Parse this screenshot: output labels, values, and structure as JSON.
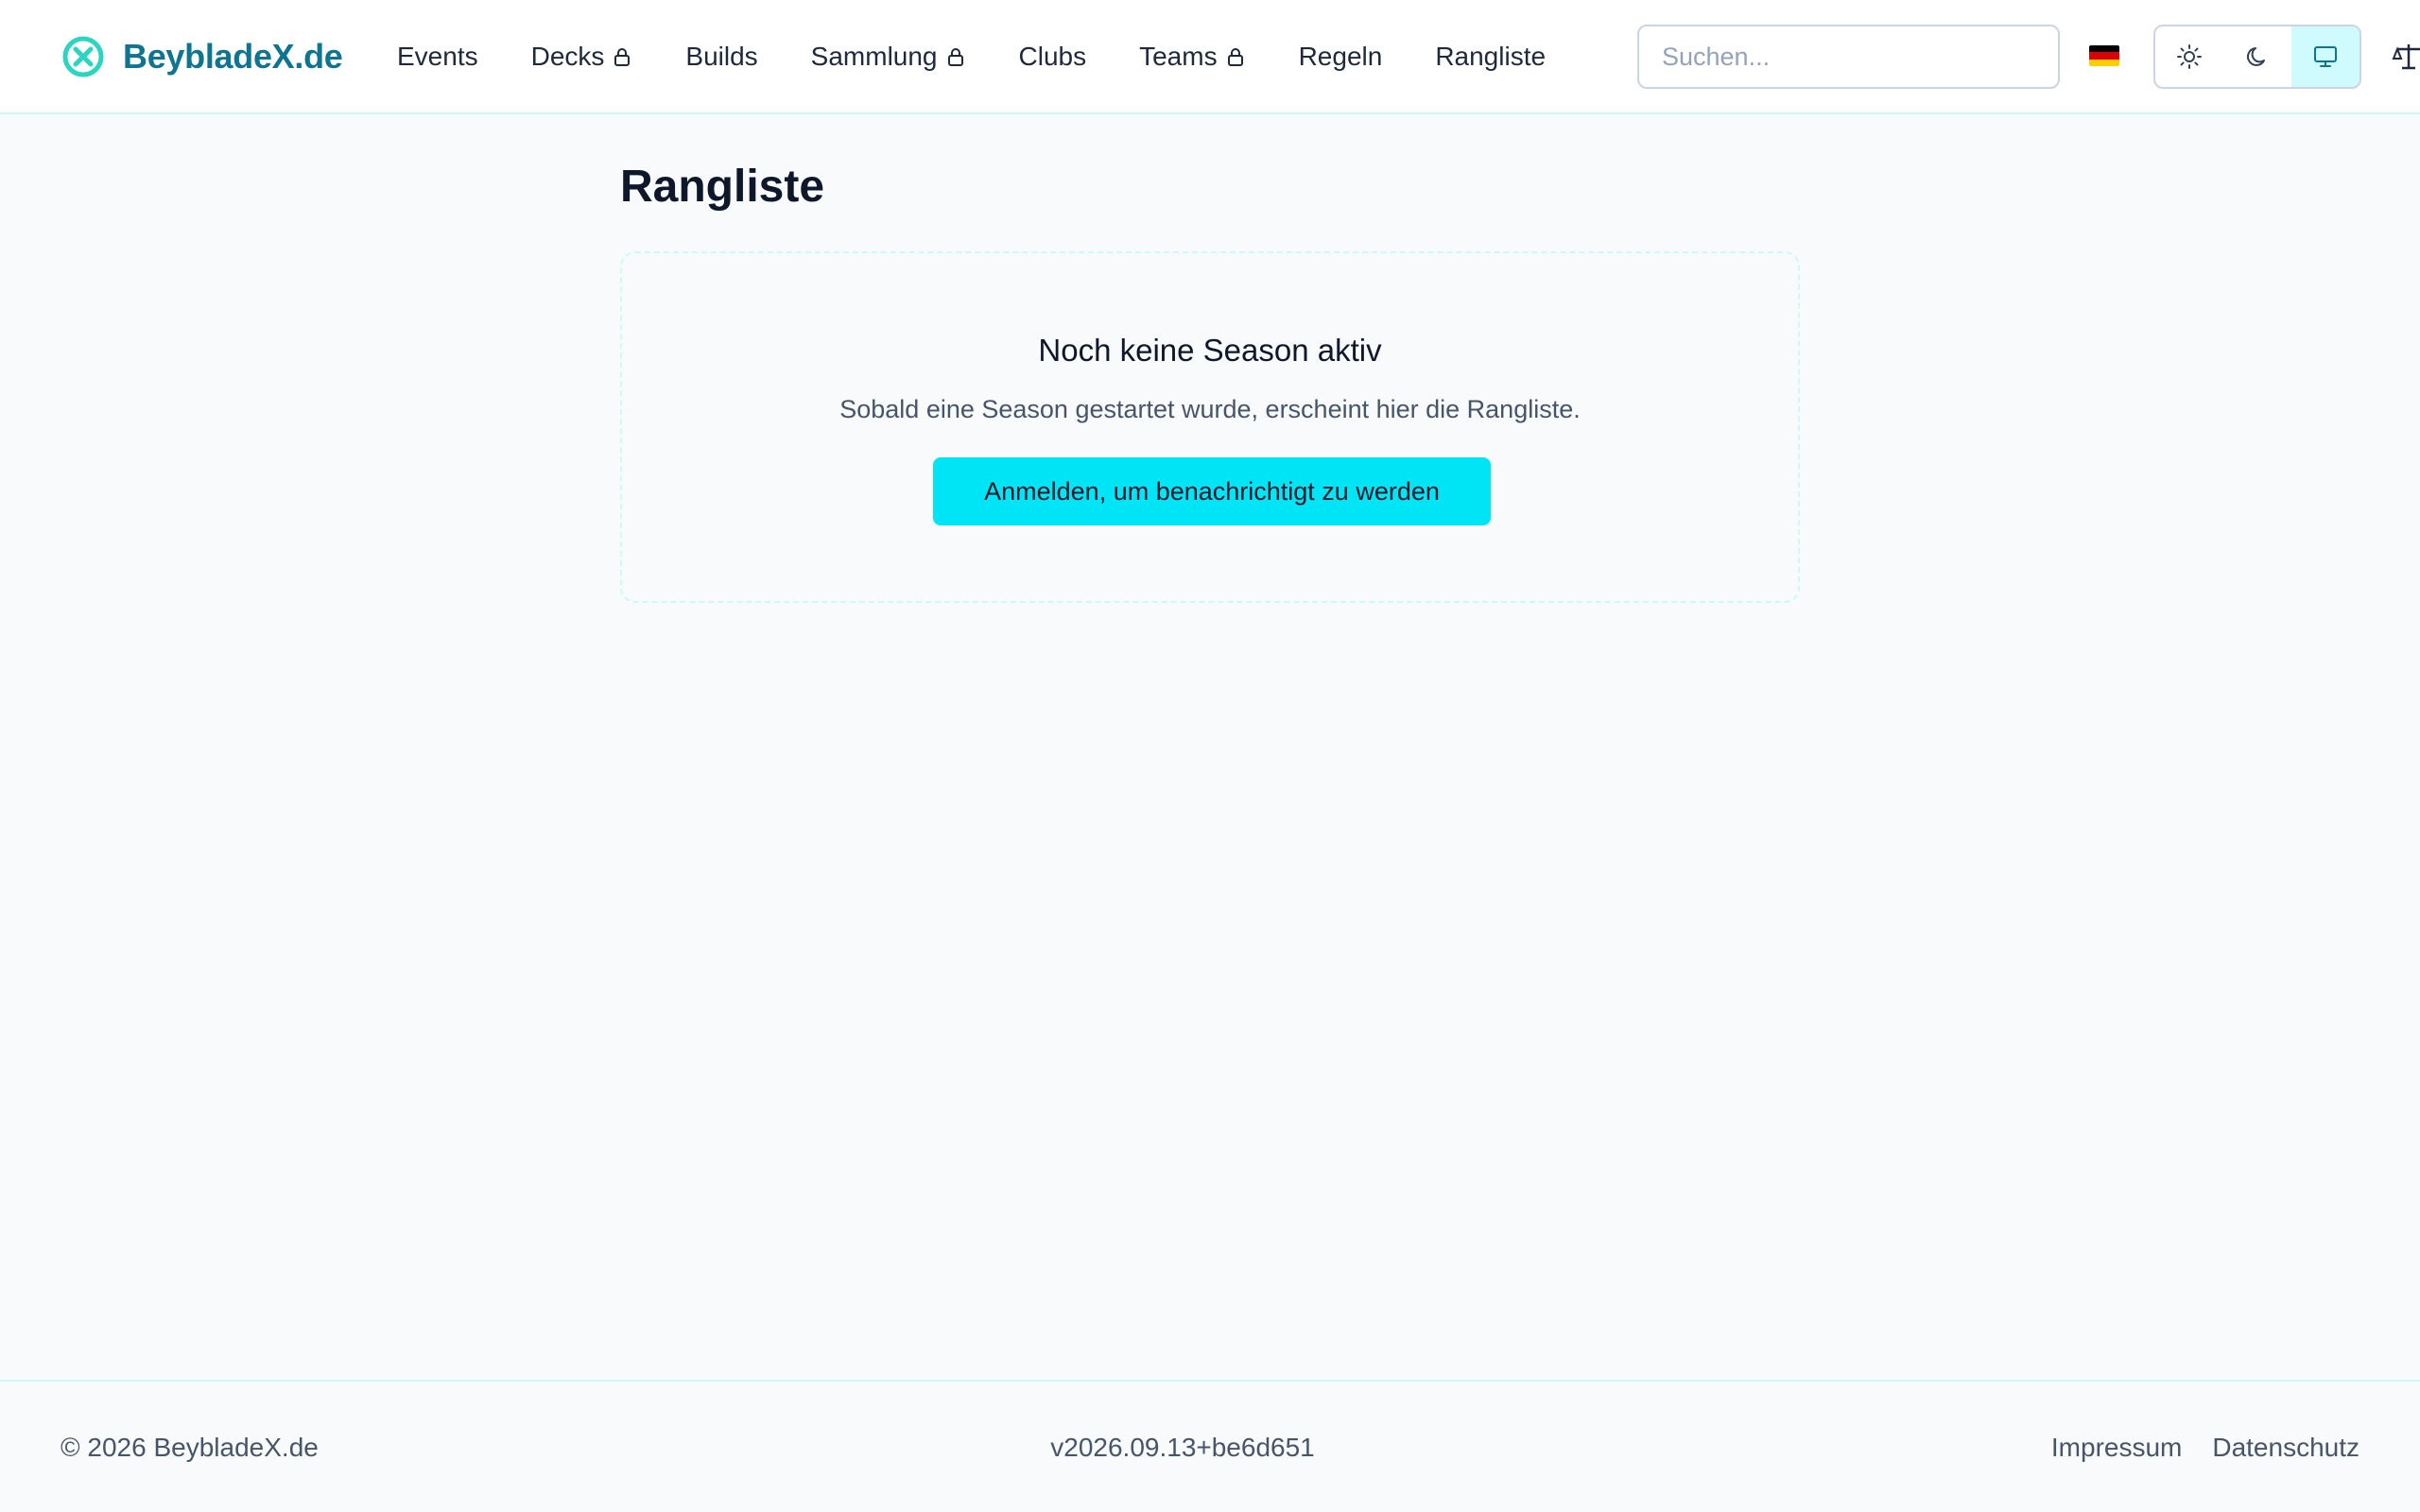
{
  "header": {
    "brand": "BeybladeX.de",
    "nav": [
      {
        "label": "Events",
        "locked": false
      },
      {
        "label": "Decks",
        "locked": true
      },
      {
        "label": "Builds",
        "locked": false
      },
      {
        "label": "Sammlung",
        "locked": true
      },
      {
        "label": "Clubs",
        "locked": false
      },
      {
        "label": "Teams",
        "locked": true
      },
      {
        "label": "Regeln",
        "locked": false
      },
      {
        "label": "Rangliste",
        "locked": false
      }
    ],
    "search_placeholder": "Suchen...",
    "language_flag": "flag-de-icon",
    "theme_options": [
      "sun-icon",
      "moon-icon",
      "monitor-icon"
    ],
    "theme_selected": "monitor-icon"
  },
  "main": {
    "title": "Rangliste",
    "empty_state": {
      "title": "Noch keine Season aktiv",
      "text": "Sobald eine Season gestartet wurde, erscheint hier die Rangliste.",
      "button": "Anmelden, um benachrichtigt zu werden"
    }
  },
  "footer": {
    "copyright": "© 2026 BeybladeX.de",
    "version": "v2026.09.13+be6d651",
    "links": [
      "Impressum",
      "Datenschutz"
    ]
  },
  "colors": {
    "brand": "#0e7490",
    "accent": "#00e5f5",
    "logo": "#2dd4bf"
  }
}
